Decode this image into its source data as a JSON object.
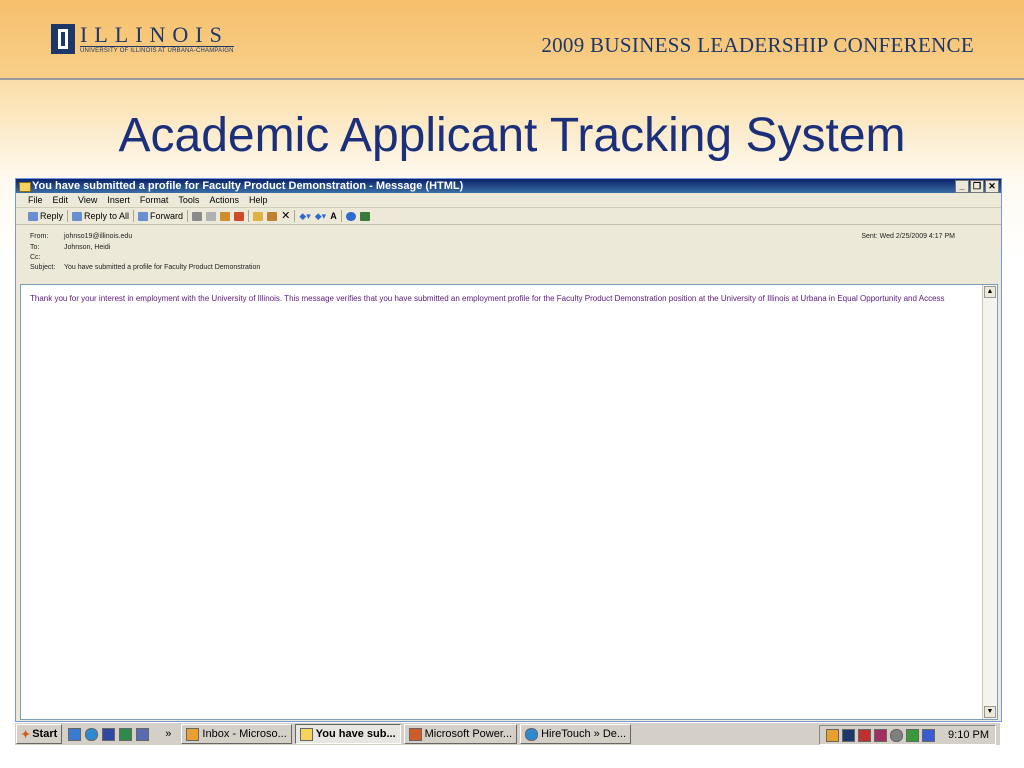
{
  "slide": {
    "logo_word": "ILLINOIS",
    "logo_sub": "UNIVERSITY OF ILLINOIS AT URBANA-CHAMPAIGN",
    "conference_title": "2009 BUSINESS LEADERSHIP CONFERENCE",
    "title": "Academic Applicant Tracking System"
  },
  "window": {
    "title": "You have submitted a profile for Faculty Product Demonstration - Message (HTML)",
    "menu": [
      "File",
      "Edit",
      "View",
      "Insert",
      "Format",
      "Tools",
      "Actions",
      "Help"
    ],
    "toolbar": {
      "reply": "Reply",
      "reply_all": "Reply to All",
      "forward": "Forward"
    },
    "header": {
      "from_label": "From:",
      "from": "johnso19@illinois.edu",
      "to_label": "To:",
      "to": "Johnson, Heidi",
      "cc_label": "Cc:",
      "cc": "",
      "subject_label": "Subject:",
      "subject": "You have submitted a profile for Faculty Product Demonstration",
      "sent_label": "Sent:",
      "sent": "Wed 2/25/2009 4:17 PM"
    },
    "body": "Thank you for your interest in employment with the University of Illinois. This message verifies that you have submitted an employment profile for the Faculty Product Demonstration position at the University of Illinois at Urbana in Equal Opportunity and Access"
  },
  "taskbar": {
    "start": "Start",
    "overflow": "»",
    "tasks": [
      "Inbox - Microso...",
      "You have sub...",
      "Microsoft Power...",
      "HireTouch » De..."
    ],
    "clock": "9:10 PM"
  },
  "colors": {
    "slide_title": "#1b2f7a",
    "brand_navy": "#1d3769",
    "message_text": "#5b1a7a",
    "titlebar": "#0a246a"
  }
}
